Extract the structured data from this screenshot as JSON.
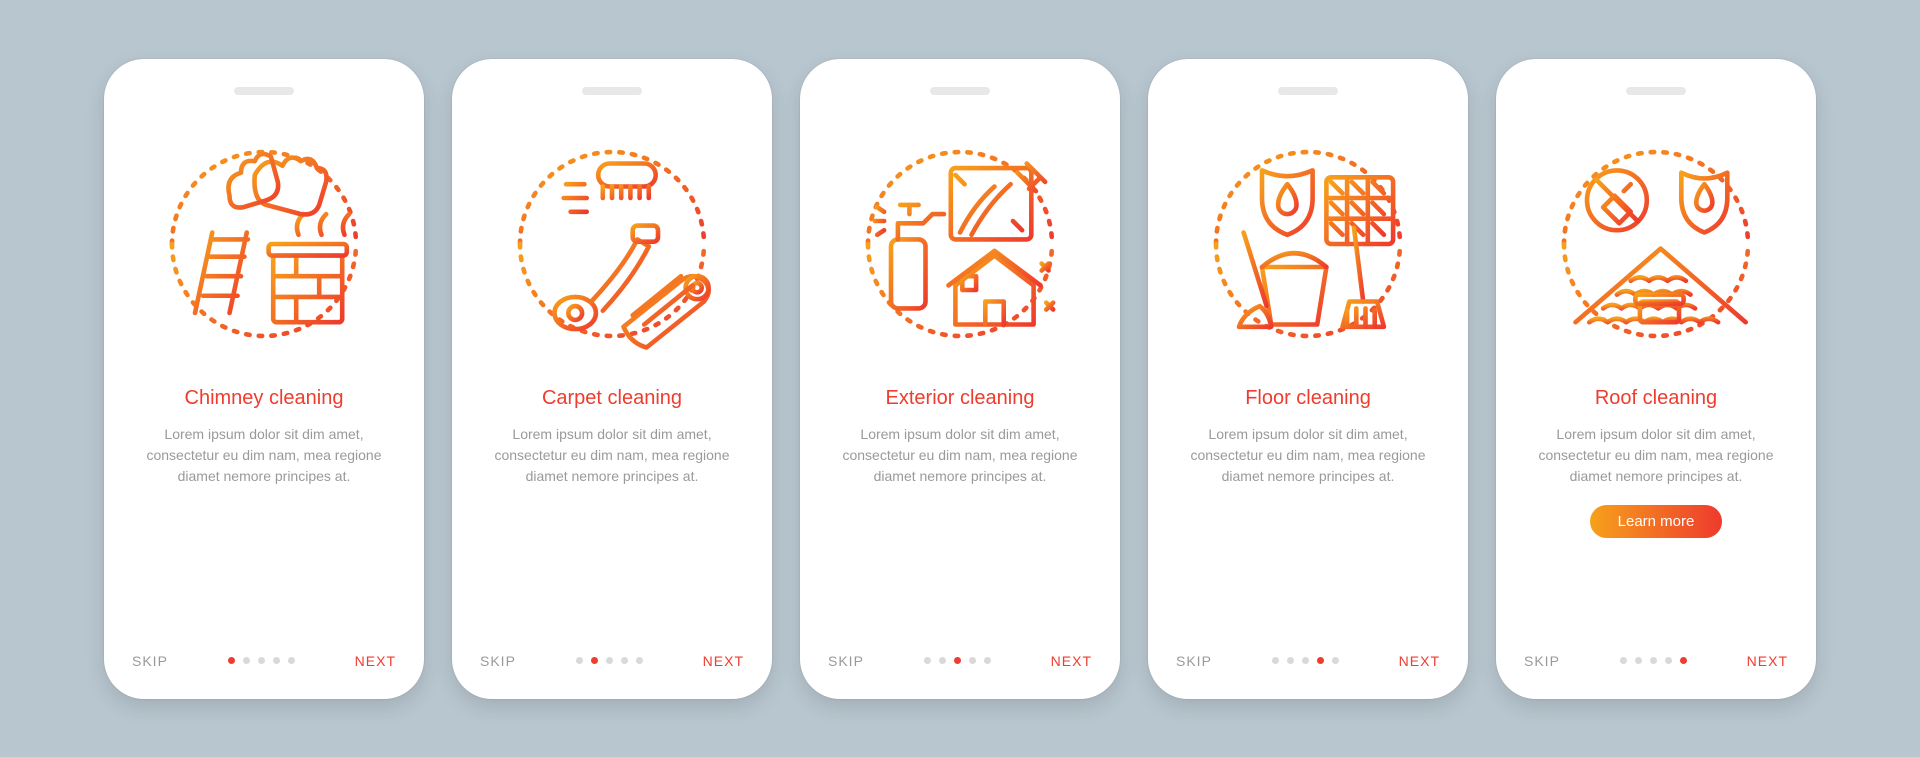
{
  "common": {
    "skip": "SKIP",
    "next": "NEXT",
    "learn_more": "Learn more",
    "body": "Lorem ipsum dolor sit dim amet, consectetur eu dim nam, mea regione diamet nemore principes at."
  },
  "screens": [
    {
      "title": "Chimney cleaning",
      "icon": "chimney-cleaning-icon",
      "active_dot": 0,
      "cta": false
    },
    {
      "title": "Carpet cleaning",
      "icon": "carpet-cleaning-icon",
      "active_dot": 1,
      "cta": false
    },
    {
      "title": "Exterior cleaning",
      "icon": "exterior-cleaning-icon",
      "active_dot": 2,
      "cta": false
    },
    {
      "title": "Floor cleaning",
      "icon": "floor-cleaning-icon",
      "active_dot": 3,
      "cta": false
    },
    {
      "title": "Roof cleaning",
      "icon": "roof-cleaning-icon",
      "active_dot": 4,
      "cta": true
    }
  ],
  "colors": {
    "accent": "#ee3c2e",
    "grad_start": "#f7a11b",
    "grad_end": "#ee3a2d",
    "muted": "#9a9a9a",
    "bg": "#b8c6cf"
  }
}
